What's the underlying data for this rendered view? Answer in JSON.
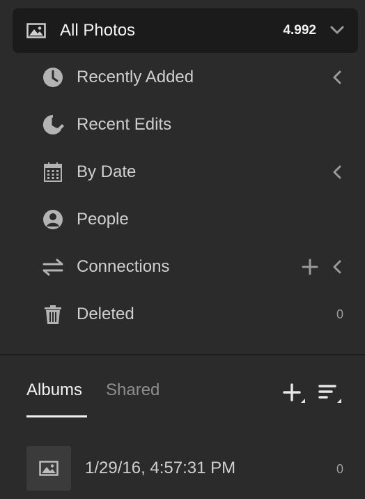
{
  "all_photos": {
    "label": "All Photos",
    "count": "4.992",
    "icon": "image-icon",
    "expand_icon": "chevron-down-icon"
  },
  "nav_items": [
    {
      "label": "Recently Added",
      "icon": "clock-icon",
      "has_chevron": true
    },
    {
      "label": "Recent Edits",
      "icon": "edit-clock-icon"
    },
    {
      "label": "By Date",
      "icon": "calendar-icon",
      "has_chevron": true
    },
    {
      "label": "People",
      "icon": "person-icon"
    },
    {
      "label": "Connections",
      "icon": "arrows-swap-icon",
      "has_plus": true,
      "has_chevron": true
    },
    {
      "label": "Deleted",
      "icon": "trash-icon",
      "count": "0"
    }
  ],
  "albums": {
    "tabs": [
      {
        "label": "Albums",
        "active": true
      },
      {
        "label": "Shared",
        "active": false
      }
    ],
    "tools": [
      "add-icon",
      "sort-icon"
    ],
    "items": [
      {
        "name": "1/29/16, 4:57:31 PM",
        "count": "0",
        "icon": "image-icon"
      }
    ]
  },
  "colors": {
    "background": "#2b2b2b",
    "header_background": "#1b1b1b",
    "text": "#cfcfcf",
    "text_active": "#f2f2f2",
    "text_muted": "#8e8e8e"
  }
}
